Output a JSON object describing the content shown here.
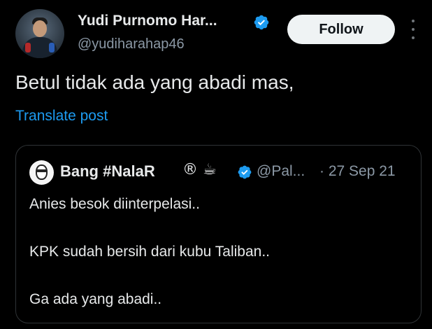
{
  "author": {
    "display_name": "Yudi Purnomo Har...",
    "handle": "@yudiharahap46",
    "verified_icon": "verified-badge-icon",
    "avatar": "profile-photo"
  },
  "follow_label": "Follow",
  "more_icon": "more-options-icon",
  "post": {
    "text": "Betul tidak ada yang abadi mas,",
    "translate_label": "Translate post"
  },
  "quoted": {
    "display_name": "Bang #NalaR",
    "emoji": "® ☕",
    "handle": "@Pal...",
    "date": "· 27 Sep 21",
    "lines": [
      "Anies besok diinterpelasi..",
      "KPK sudah bersih dari kubu Taliban..",
      "Ga ada yang abadi.."
    ]
  },
  "colors": {
    "background": "#000000",
    "text": "#e7e9ea",
    "secondary": "#8b98a5",
    "link": "#1d9bf0",
    "verified": "#1d9bf0",
    "follow_bg": "#eff3f4"
  }
}
